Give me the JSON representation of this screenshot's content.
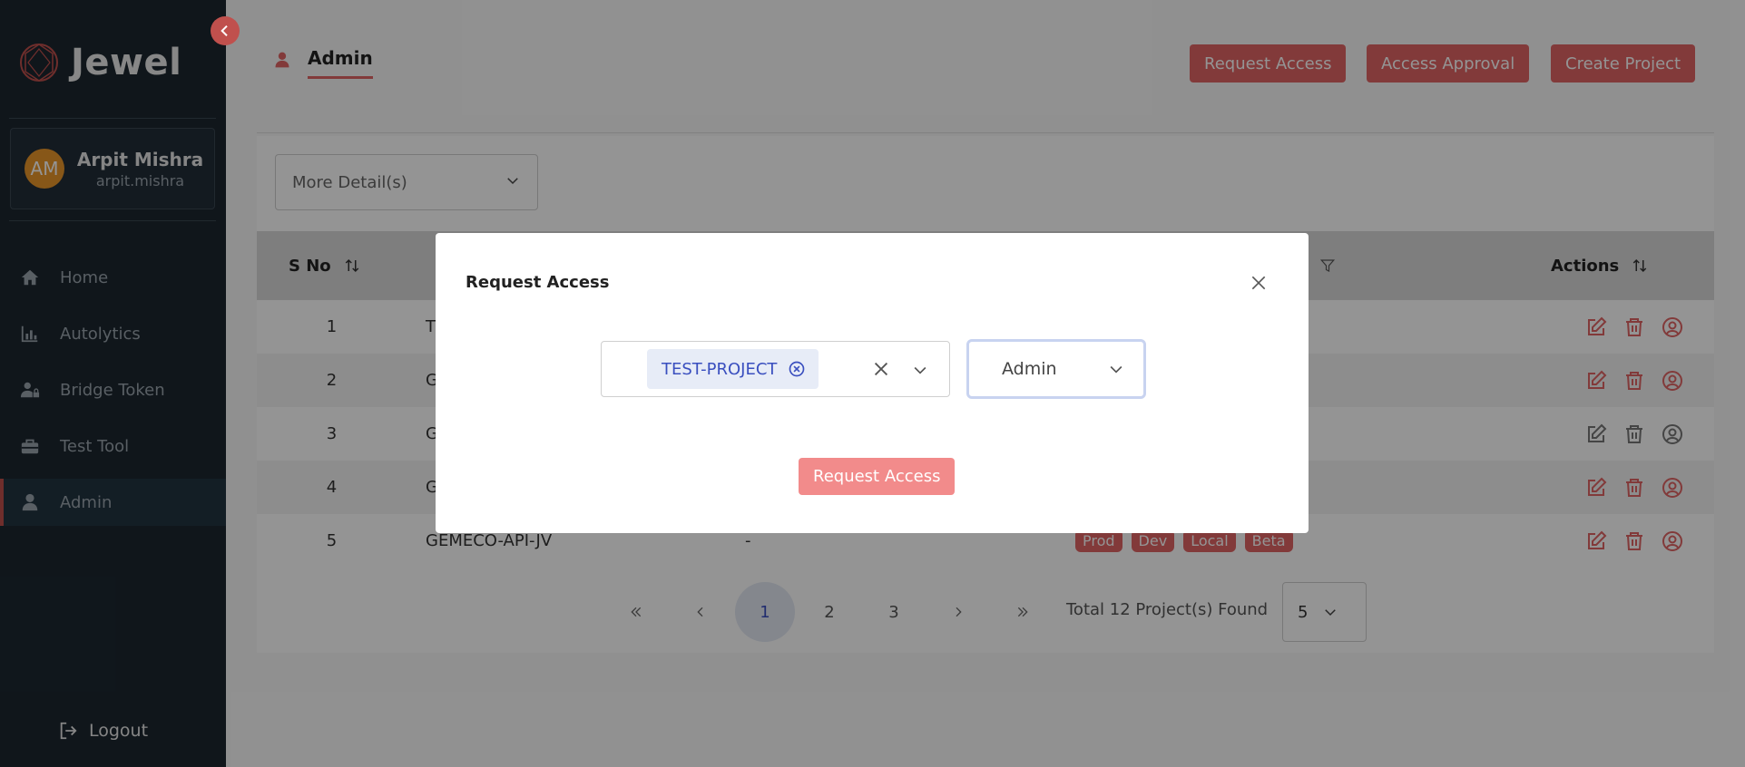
{
  "app": {
    "name": "Jewel"
  },
  "user": {
    "initials": "AM",
    "name": "Arpit Mishra",
    "handle": "arpit.mishra"
  },
  "sidebar": {
    "items": [
      {
        "label": "Home",
        "icon": "home-icon"
      },
      {
        "label": "Autolytics",
        "icon": "bar-chart-icon"
      },
      {
        "label": "Bridge Token",
        "icon": "user-lock-icon"
      },
      {
        "label": "Test Tool",
        "icon": "toolbox-icon"
      },
      {
        "label": "Admin",
        "icon": "user-icon",
        "active": true
      }
    ],
    "logout_label": "Logout"
  },
  "header": {
    "title": "Admin",
    "buttons": {
      "request_access": "Request Access",
      "access_approval": "Access Approval",
      "create_project": "Create Project"
    }
  },
  "filters": {
    "more_details": "More Detail(s)"
  },
  "table": {
    "headers": {
      "sno": "S No",
      "actions": "Actions"
    },
    "rows": [
      {
        "sno": "1",
        "name": "T",
        "desc": "",
        "tags": []
      },
      {
        "sno": "2",
        "name": "G",
        "desc": "",
        "tags": []
      },
      {
        "sno": "3",
        "name": "G",
        "desc": "",
        "tags": []
      },
      {
        "sno": "4",
        "name": "G",
        "desc": "",
        "tags": []
      },
      {
        "sno": "5",
        "name": "GEMECO-API-JV",
        "desc": "-",
        "tags": [
          "Prod",
          "Dev",
          "Local",
          "Beta"
        ]
      }
    ]
  },
  "pagination": {
    "pages": [
      "1",
      "2",
      "3"
    ],
    "current": "1",
    "total_text": "Total 12 Project(s) Found",
    "per_page": "5"
  },
  "modal": {
    "title": "Request Access",
    "selected_project": "TEST-PROJECT",
    "role": "Admin",
    "submit_label": "Request Access"
  },
  "colors": {
    "sidebar_bg": "#1c2730",
    "accent": "#e06565",
    "accent_light": "#f28b8b",
    "chip_text": "#3a4fbf"
  }
}
